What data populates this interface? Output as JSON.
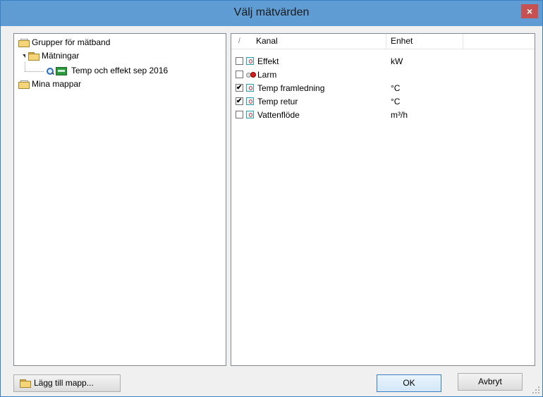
{
  "window": {
    "title": "Välj mätvärden",
    "close_glyph": "×"
  },
  "tree": {
    "root_groups": "Grupper för mätband",
    "matningar": "Mätningar",
    "measurement": "Temp och effekt sep 2016",
    "my_folders": "Mina mappar"
  },
  "list": {
    "headers": {
      "sort_mark": "/",
      "kanal": "Kanal",
      "enhet": "Enhet"
    },
    "rows": [
      {
        "kanal": "Effekt",
        "enhet": "kW",
        "checked": false,
        "icon": "meter-icon"
      },
      {
        "kanal": "Larm",
        "enhet": "",
        "checked": false,
        "icon": "alarm-icon"
      },
      {
        "kanal": "Temp framledning",
        "enhet": "°C",
        "checked": true,
        "icon": "meter-icon"
      },
      {
        "kanal": "Temp retur",
        "enhet": "°C",
        "checked": true,
        "icon": "meter-icon"
      },
      {
        "kanal": "Vattenflöde",
        "enhet": "m³/h",
        "checked": false,
        "icon": "meter-icon"
      }
    ]
  },
  "buttons": {
    "add_folder": "Lägg till mapp...",
    "ok": "OK",
    "cancel": "Avbryt"
  }
}
